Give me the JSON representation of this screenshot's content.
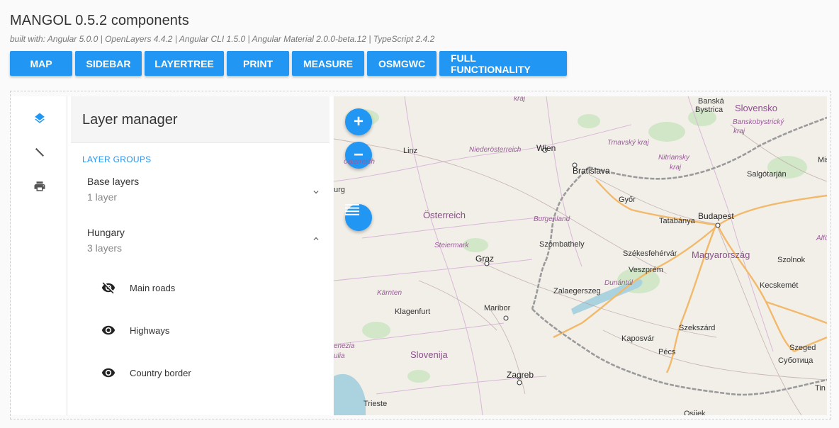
{
  "app": {
    "title": "MANGOL 0.5.2 components",
    "subtitle": "built with: Angular 5.0.0 | OpenLayers 4.4.2 | Angular CLI 1.5.0 | Angular Material 2.0.0-beta.12 | TypeScript 2.4.2"
  },
  "nav_buttons": [
    "MAP",
    "SIDEBAR",
    "LAYERTREE",
    "PRINT",
    "MEASURE",
    "OSMGWC",
    "FULL FUNCTIONALITY"
  ],
  "sidebar": {
    "icons": [
      "layers-icon",
      "ruler-icon",
      "print-icon"
    ],
    "accent": "#2196f3"
  },
  "layer_manager": {
    "title": "Layer manager",
    "groups_caption": "LAYER GROUPS",
    "groups": [
      {
        "name": "Base layers",
        "count": "1 layer",
        "expanded": false
      },
      {
        "name": "Hungary",
        "count": "3 layers",
        "expanded": true
      }
    ],
    "layers": [
      {
        "name": "Main roads",
        "visible": false
      },
      {
        "name": "Highways",
        "visible": true
      },
      {
        "name": "Country border",
        "visible": true
      }
    ]
  },
  "map": {
    "controls": {
      "zoom_in": "+",
      "zoom_out": "−"
    },
    "labels": {
      "krajTop": "kraj",
      "banska": "Banská",
      "bystrica": "Bystrica",
      "slovensko": "Slovensko",
      "banskobystricky": "Banskobystrický",
      "kraj2": "kraj",
      "linz": "Linz",
      "niederosterreich": "Niederösterreich",
      "wien": "Wien",
      "trnavsky": "Trnavský kraj",
      "nitriansky": "Nitriansky",
      "kraj3": "kraj",
      "oerreich": "österreich",
      "bratislava": "Bratislava",
      "salgotarjan": "Salgótarján",
      "mis": "Mis",
      "urg": "urg",
      "gyor": "Győr",
      "osterreich": "Österreich",
      "budapest": "Budapest",
      "burgenland": "Burgenland",
      "tatabanya": "Tatabánya",
      "alfo": "Alfö",
      "steiermark": "Steiermark",
      "szombathely": "Szombathely",
      "szekesfehervar": "Székesfehérvár",
      "magyarorszag": "Magyarország",
      "graz": "Graz",
      "veszprem": "Veszprém",
      "szolnok": "Szolnok",
      "duna": "Dunántúl",
      "zalaegerszeg": "Zalaegerszeg",
      "kecskemet": "Kecskemét",
      "karnten": "Kärnten",
      "klagenfurt": "Klagenfurt",
      "maribor": "Maribor",
      "szekszard": "Szekszárd",
      "kaposvar": "Kaposvár",
      "enezia": "enezia",
      "ulia": "ulia",
      "slovenija": "Slovenija",
      "pecs": "Pécs",
      "szeged": "Szeged",
      "subotica": "Суботица",
      "zagreb": "Zagreb",
      "tin": "Tin",
      "trieste": "Trieste",
      "osijek": "Osijek"
    }
  }
}
